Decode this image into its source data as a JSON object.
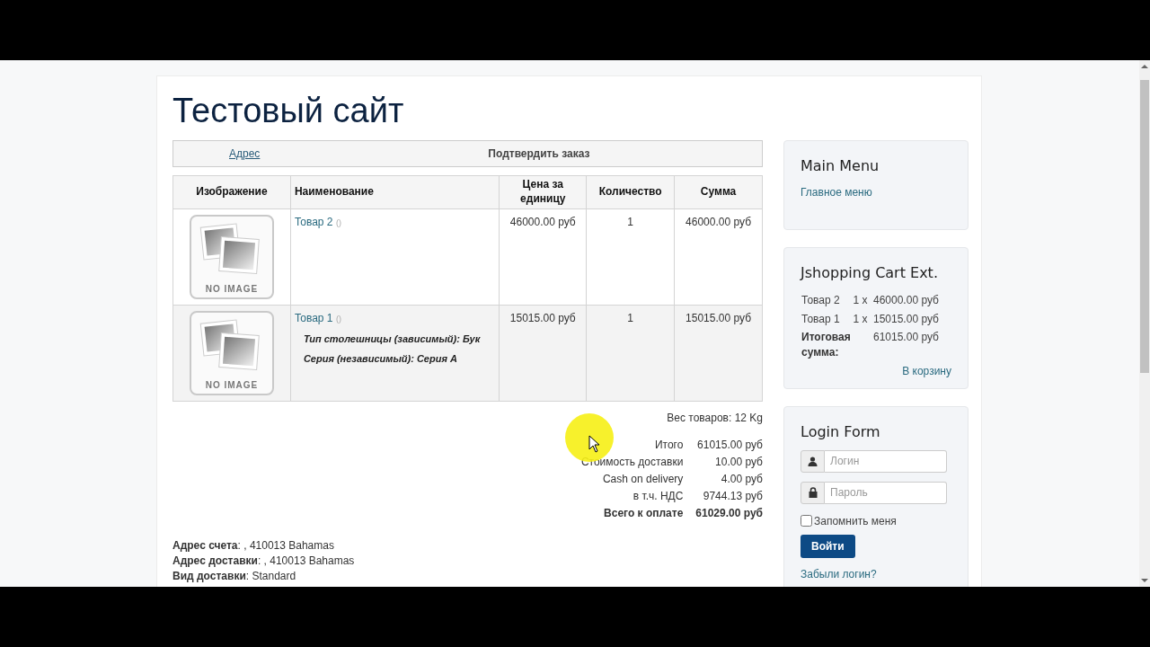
{
  "site_title": "Тестовый сайт",
  "checkout_steps": [
    {
      "label": "Адрес",
      "kind": "link"
    },
    {
      "label": "Подтвердить заказ",
      "kind": "current"
    }
  ],
  "cart_table": {
    "columns": [
      "Изображение",
      "Наименование",
      "Цена за единицу",
      "Количество",
      "Сумма"
    ],
    "rows": [
      {
        "image_label": "NO IMAGE",
        "name": "Товар 2",
        "note": "()",
        "attributes": [],
        "price": "46000.00 руб",
        "quantity": "1",
        "total": "46000.00 руб"
      },
      {
        "image_label": "NO IMAGE",
        "name": "Товар 1",
        "note": "()",
        "attributes": [
          "Тип столешницы (зависимый): Бук",
          "Серия (независимый): Серия A"
        ],
        "price": "15015.00 руб",
        "quantity": "1",
        "total": "15015.00 руб"
      }
    ]
  },
  "weight": "Вес товаров: 12 Kg",
  "summary": [
    {
      "label": "Итого",
      "value": "61015.00 руб",
      "kind": "normal"
    },
    {
      "label": "Стоимость доставки",
      "value": "10.00 руб",
      "kind": "normal"
    },
    {
      "label": "Cash on delivery",
      "value": "4.00 руб",
      "kind": "normal"
    },
    {
      "label": "в т.ч. НДС",
      "value": "9744.13 руб",
      "kind": "normal"
    },
    {
      "label": "Всего к оплате",
      "value": "61029.00 руб",
      "kind": "total"
    }
  ],
  "addresses": [
    "**Адрес счета**: , 410013 Bahamas",
    "**Адрес доставки**: , 410013 Bahamas",
    "**Вид доставки**: Standard"
  ],
  "sidebar": {
    "main_menu": {
      "title": "Main Menu",
      "links": [
        "Главное меню"
      ]
    },
    "cart": {
      "title": "Jshopping Cart Ext.",
      "items": [
        {
          "name": "Товар 2",
          "quantity": "1 x",
          "price": "46000.00 руб"
        },
        {
          "name": "Товар 1",
          "quantity": "1 x",
          "price": "15015.00 руб"
        }
      ],
      "total_label": "Итоговая сумма:",
      "total_value": "61015.00 руб",
      "link": "В корзину"
    },
    "login": {
      "title": "Login Form",
      "fields": [
        {
          "kind": "user",
          "placeholder": "Логин"
        },
        {
          "kind": "lock",
          "placeholder": "Пароль"
        }
      ],
      "remember": {
        "label": "Запомнить меня",
        "checked": false
      },
      "button": "Войти",
      "links": [
        "Забыли логин?"
      ]
    }
  }
}
